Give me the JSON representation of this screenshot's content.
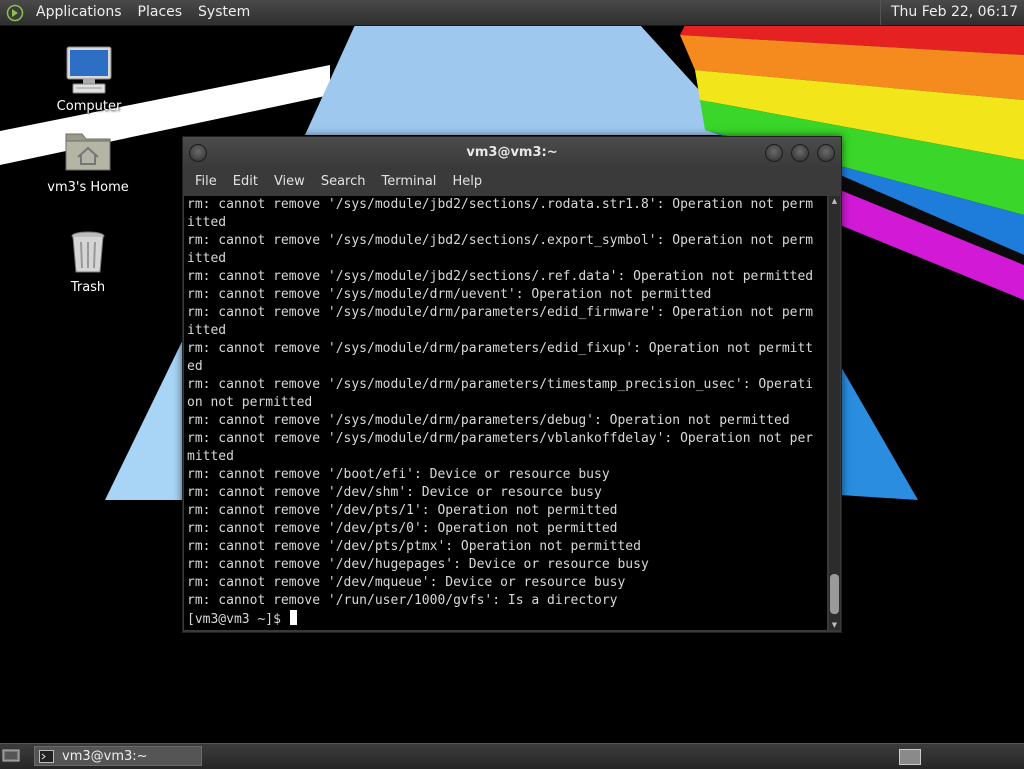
{
  "top_panel": {
    "menus": [
      "Applications",
      "Places",
      "System"
    ],
    "clock": "Thu Feb 22, 06:17"
  },
  "desktop": {
    "icons": [
      {
        "label": "Computer",
        "icon": "computer-icon"
      },
      {
        "label": "vm3's Home",
        "icon": "home-folder-icon"
      },
      {
        "label": "Trash",
        "icon": "trash-icon"
      }
    ]
  },
  "terminal": {
    "title": "vm3@vm3:~",
    "menus": [
      "File",
      "Edit",
      "View",
      "Search",
      "Terminal",
      "Help"
    ],
    "lines": [
      "rm: cannot remove '/sys/module/jbd2/sections/.rodata.str1.8': Operation not perm",
      "itted",
      "rm: cannot remove '/sys/module/jbd2/sections/.export_symbol': Operation not perm",
      "itted",
      "rm: cannot remove '/sys/module/jbd2/sections/.ref.data': Operation not permitted",
      "rm: cannot remove '/sys/module/drm/uevent': Operation not permitted",
      "rm: cannot remove '/sys/module/drm/parameters/edid_firmware': Operation not perm",
      "itted",
      "rm: cannot remove '/sys/module/drm/parameters/edid_fixup': Operation not permitt",
      "ed",
      "rm: cannot remove '/sys/module/drm/parameters/timestamp_precision_usec': Operati",
      "on not permitted",
      "rm: cannot remove '/sys/module/drm/parameters/debug': Operation not permitted",
      "rm: cannot remove '/sys/module/drm/parameters/vblankoffdelay': Operation not per",
      "mitted",
      "rm: cannot remove '/boot/efi': Device or resource busy",
      "rm: cannot remove '/dev/shm': Device or resource busy",
      "rm: cannot remove '/dev/pts/1': Operation not permitted",
      "rm: cannot remove '/dev/pts/0': Operation not permitted",
      "rm: cannot remove '/dev/pts/ptmx': Operation not permitted",
      "rm: cannot remove '/dev/hugepages': Device or resource busy",
      "rm: cannot remove '/dev/mqueue': Device or resource busy",
      "rm: cannot remove '/run/user/1000/gvfs': Is a directory"
    ],
    "prompt": "[vm3@vm3 ~]$ "
  },
  "taskbar": {
    "windows": [
      {
        "label": "vm3@vm3:~",
        "icon": "terminal-icon"
      }
    ]
  }
}
